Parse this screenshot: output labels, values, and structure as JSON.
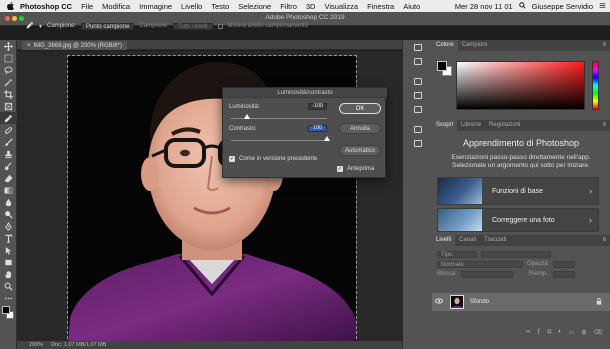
{
  "menubar": {
    "app_name": "Photoshop CC",
    "items": [
      "File",
      "Modifica",
      "Immagine",
      "Livello",
      "Testo",
      "Selezione",
      "Filtro",
      "3D",
      "Visualizza",
      "Finestra",
      "Aiuto"
    ],
    "clock": "Mer 28 nov  11 01",
    "user": "Giuseppe Servidio"
  },
  "window": {
    "title": "Adobe Photoshop CC 2019"
  },
  "optionsbar": {
    "sample_label": "Campione:",
    "sample_value": "Punto campione",
    "layers_value": "Tutti i livelli",
    "show_ring": "Mostra anello campionamento"
  },
  "document": {
    "tab_label": "IMG_3669.jpg @ 200% (RGB/8*)",
    "close_glyph": "×",
    "zoom": "200%",
    "doc_info": "Doc: 1,07 MB/1,07 MB"
  },
  "panels": {
    "color_tabs": [
      "Colore",
      "Campioni"
    ],
    "learn_tabs": [
      "Scopri",
      "Librerie",
      "Regolazioni"
    ],
    "learn_title": "Apprendimento di Photoshop",
    "learn_desc": "Esercitazioni passo-passo direttamente nell'app. Selezionate un argomento qui sotto per iniziare.",
    "learn_cards": [
      "Funzioni di base",
      "Correggere una foto"
    ],
    "layers_tabs": [
      "Livelli",
      "Canali",
      "Tracciati"
    ],
    "layers_filter": "Tipo",
    "blend_mode": "Normale",
    "opacity_label": "Opacità:",
    "lock_label": "Blocca:",
    "fill_label": "Riemp.:",
    "layer_name": "Sfondo"
  },
  "dialog": {
    "title": "Luminosità/contrasto",
    "brightness_label": "Luminosità:",
    "brightness_value": "-100",
    "contrast_label": "Contrasto:",
    "contrast_value": "100",
    "brightness_level": -100,
    "contrast_level": 100,
    "ok_label": "OK",
    "cancel_label": "Annulla",
    "auto_label": "Automatico",
    "legacy_label": "Come in versione precedente",
    "legacy_checked": true,
    "preview_label": "Anteprima",
    "preview_checked": true
  },
  "colors": {
    "foreground": "#000000",
    "background": "#ffffff",
    "accent": "#2a5fb3"
  }
}
